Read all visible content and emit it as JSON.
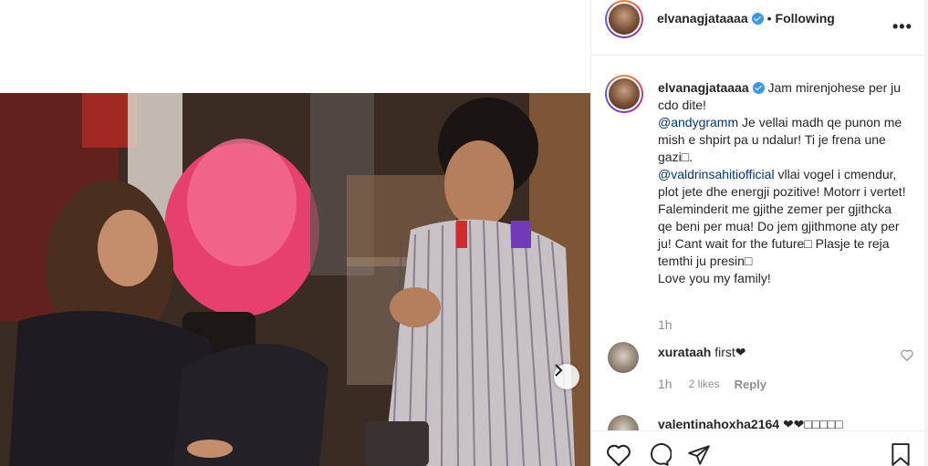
{
  "post": {
    "username": "elvanagjataaaa",
    "follow_status": "Following",
    "more_icon": "more-icon"
  },
  "caption": {
    "username": "elvanagjataaaa",
    "line1": "Jam mirenjohese per ju cdo dite!",
    "mention1": "@andygramm",
    "text1": "Je vellai madh qe punon me mish e shpirt pa u ndalur! Ti je frena une gazi□.",
    "mention2": "@valdrinsahitiofficial",
    "text2": "vllai vogel i cmendur, plot jete dhe energji pozitive! Motorr i vertet!",
    "text3": "Faleminderit me gjithe zemer per gjithcka qe beni per mua! Do jem gjithmone aty per ju! Cant wait for the future□ Plasje te reja temthi ju presin□",
    "text4": "Love you my family!",
    "time": "1h"
  },
  "comments": [
    {
      "username": "xurataah",
      "text": "first❤",
      "time": "1h",
      "likes": "2 likes",
      "reply": "Reply"
    },
    {
      "username": "valentinahoxha2164",
      "text": "❤❤□□□□□"
    }
  ],
  "colors": {
    "accent_blue": "#3897f0",
    "mention_color": "#00376b",
    "muted_text": "#8e8e8e"
  }
}
